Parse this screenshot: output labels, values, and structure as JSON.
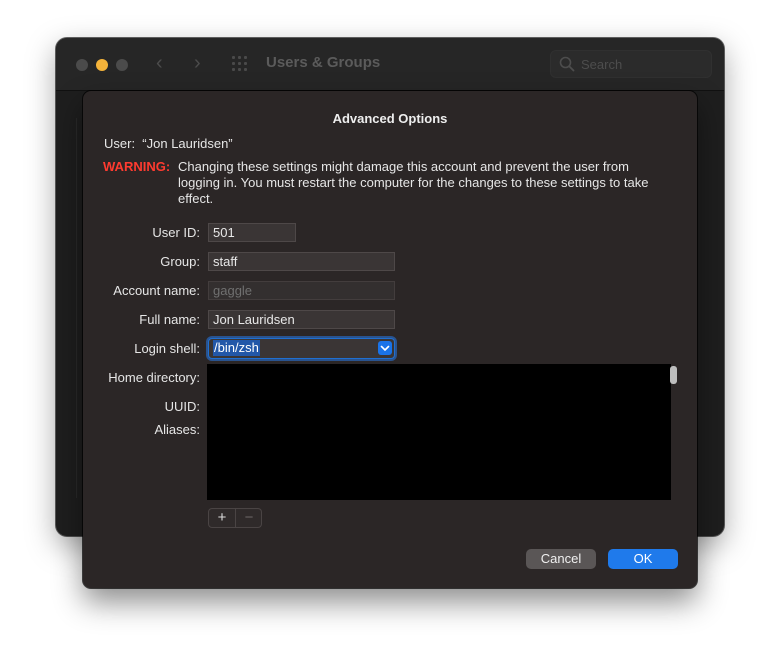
{
  "window": {
    "title": "Users & Groups",
    "search_placeholder": "Search"
  },
  "sheet": {
    "title": "Advanced Options",
    "user_label": "User:",
    "user_value": "“Jon Lauridsen”",
    "warning_label": "WARNING:",
    "warning_text": "Changing these settings might damage this account and prevent the user from logging in. You must restart the computer for the changes to these settings to take effect.",
    "fields": {
      "user_id": {
        "label": "User ID:",
        "value": "501"
      },
      "group": {
        "label": "Group:",
        "value": "staff"
      },
      "account_name": {
        "label": "Account name:",
        "placeholder": "gaggle"
      },
      "full_name": {
        "label": "Full name:",
        "value": "Jon Lauridsen"
      },
      "login_shell": {
        "label": "Login shell:",
        "value": "/bin/zsh"
      },
      "home_directory": {
        "label": "Home directory:"
      },
      "uuid": {
        "label": "UUID:"
      },
      "aliases": {
        "label": "Aliases:"
      }
    },
    "add_label": "+",
    "remove_label": "−",
    "cancel_label": "Cancel",
    "ok_label": "OK"
  },
  "colors": {
    "warning": "#ff3b30",
    "accent": "#1f7aeb"
  }
}
